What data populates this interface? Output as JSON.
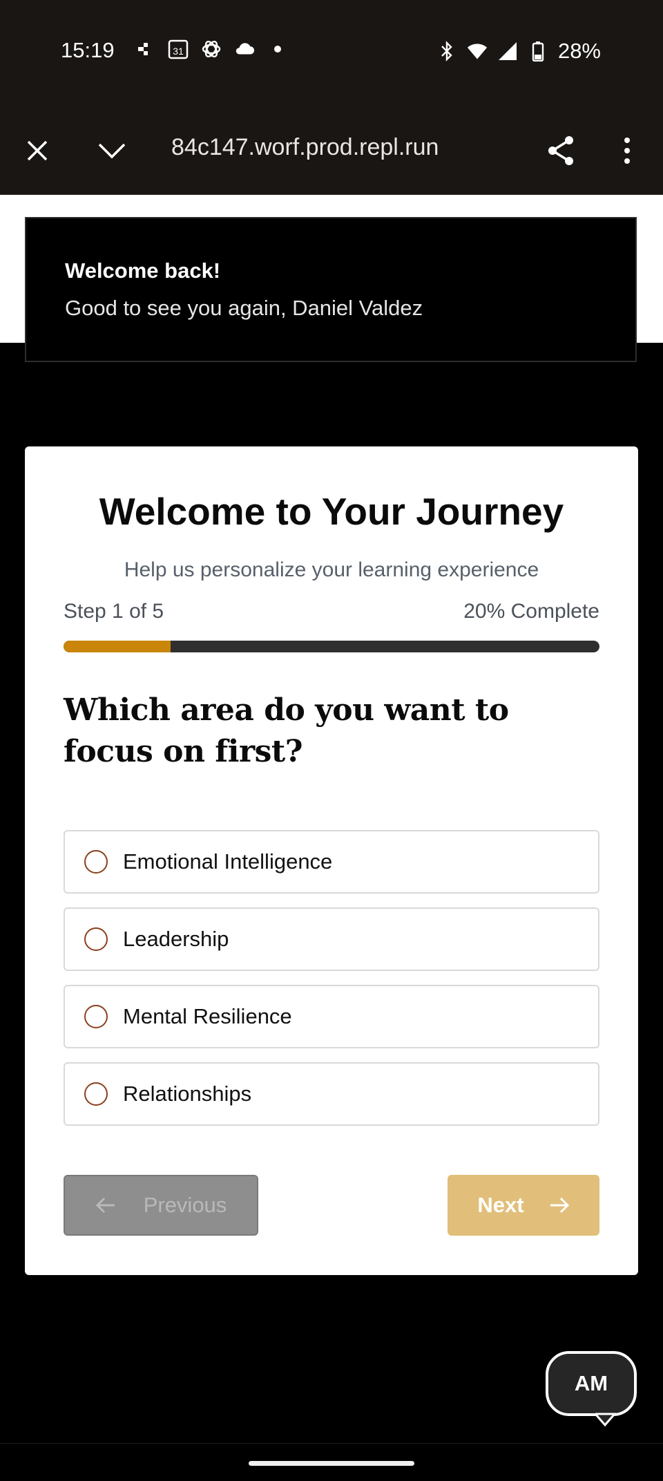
{
  "status_bar": {
    "time": "15:19",
    "left_icons": [
      "slack-icon",
      "calendar-icon",
      "openai-icon",
      "cloud-icon",
      "dot-icon"
    ],
    "calendar_day": "31",
    "right_icons": [
      "bluetooth-icon",
      "wifi-icon",
      "signal-icon",
      "battery-icon"
    ],
    "battery": "28%"
  },
  "browser": {
    "url": "84c147.worf.prod.repl.run",
    "buttons": [
      "close-icon",
      "chevron-down-icon",
      "share-icon",
      "more-vert-icon"
    ]
  },
  "toast": {
    "title": "Welcome back!",
    "message": "Good to see you again, Daniel Valdez"
  },
  "onboarding": {
    "title": "Welcome to Your Journey",
    "subtitle": "Help us personalize your learning experience",
    "step_text": "Step 1 of 5",
    "percent_text": "20% Complete",
    "progress_fraction": 0.2,
    "question": "Which area do you want to focus on first?",
    "options": [
      {
        "label": "Emotional Intelligence"
      },
      {
        "label": "Leadership"
      },
      {
        "label": "Mental Resilience"
      },
      {
        "label": "Relationships"
      }
    ],
    "prev_label": "Previous",
    "next_label": "Next"
  },
  "avatar": {
    "initials": "AM"
  },
  "colors": {
    "accent": "#c9860b",
    "next_button": "#e1bf7a",
    "radio_border": "#8b3e1c"
  }
}
